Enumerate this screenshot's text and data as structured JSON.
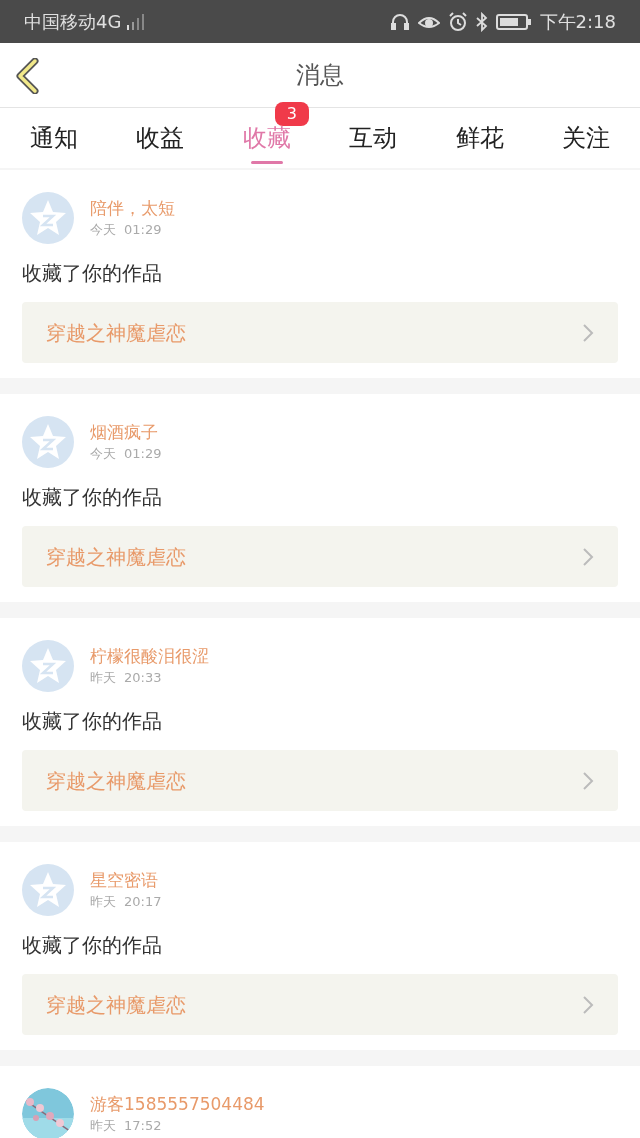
{
  "status_bar": {
    "carrier": "中国移动4G",
    "time": "下午2:18"
  },
  "header": {
    "title": "消息"
  },
  "tabs": [
    {
      "label": "通知",
      "selected": false
    },
    {
      "label": "收益",
      "selected": false
    },
    {
      "label": "收藏",
      "selected": true,
      "badge": "3"
    },
    {
      "label": "互动",
      "selected": false
    },
    {
      "label": "鲜花",
      "selected": false
    },
    {
      "label": "关注",
      "selected": false
    }
  ],
  "messages": [
    {
      "kind": "default",
      "name": "陪伴，太短",
      "day": "今天",
      "time": "01:29",
      "text": "收藏了你的作品",
      "book": "穿越之神魔虐恋"
    },
    {
      "kind": "default",
      "name": "烟酒疯子",
      "day": "今天",
      "time": "01:29",
      "text": "收藏了你的作品",
      "book": "穿越之神魔虐恋"
    },
    {
      "kind": "default",
      "name": "柠檬很酸泪很涩",
      "day": "昨天",
      "time": "20:33",
      "text": "收藏了你的作品",
      "book": "穿越之神魔虐恋"
    },
    {
      "kind": "default",
      "name": "星空密语",
      "day": "昨天",
      "time": "20:17",
      "text": "收藏了你的作品",
      "book": "穿越之神魔虐恋"
    },
    {
      "kind": "picture",
      "name": "游客1585557504484",
      "day": "昨天",
      "time": "17:52"
    }
  ]
}
